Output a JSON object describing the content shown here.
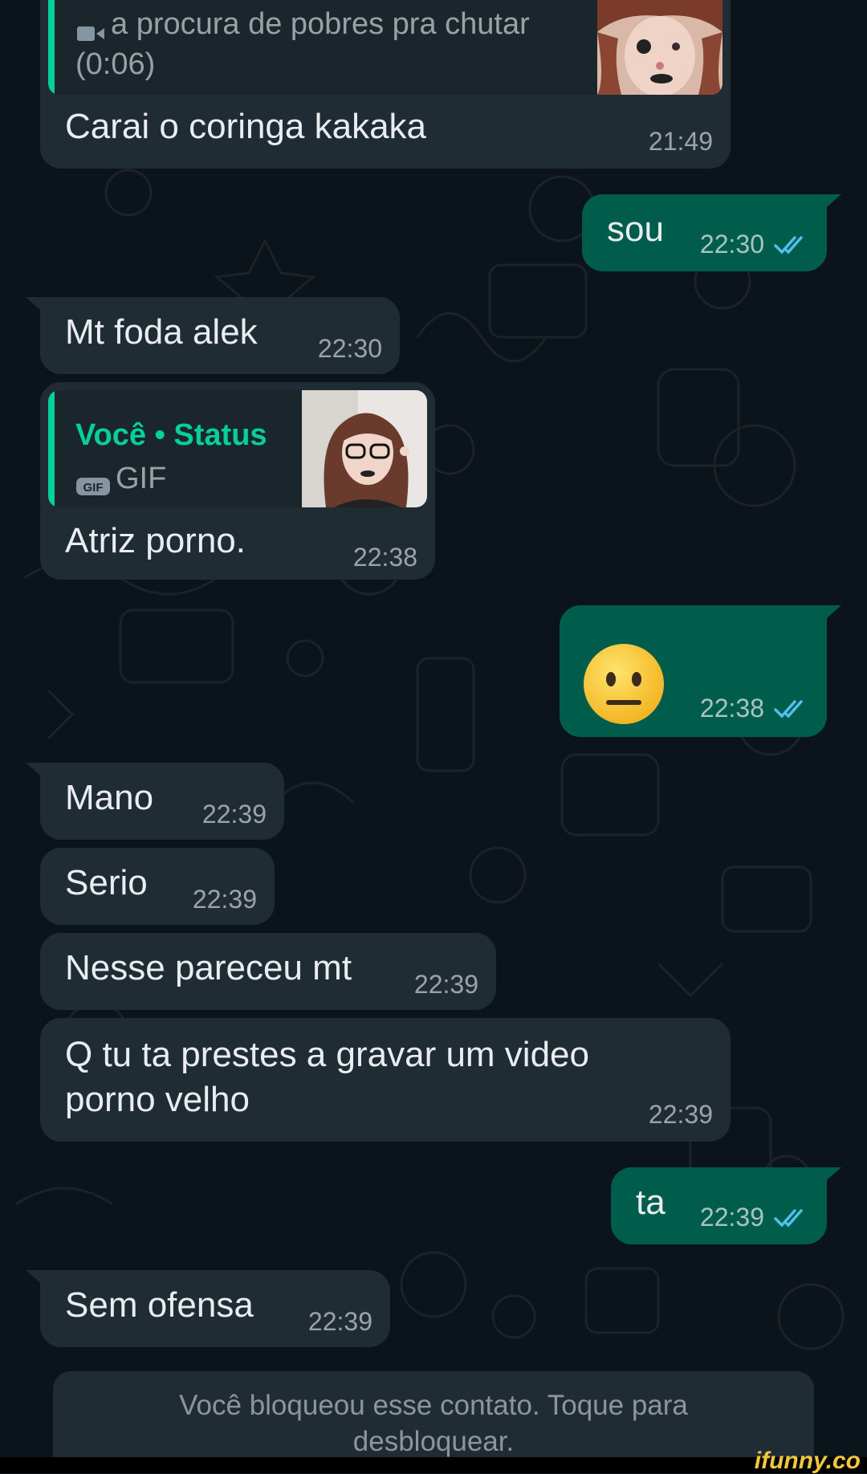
{
  "messages": {
    "m1": {
      "quote_text": "a procura de pobres pra chutar",
      "quote_duration": "(0:06)",
      "text": "Carai o coringa kakaka",
      "time": "21:49"
    },
    "m2": {
      "text": "sou",
      "time": "22:30",
      "status": "read"
    },
    "m3": {
      "text": "Mt foda alek",
      "time": "22:30"
    },
    "m4": {
      "quote_author": "Você • Status",
      "quote_media": "GIF",
      "text": "Atriz porno.",
      "time": "22:38"
    },
    "m5": {
      "emoji": "😐",
      "time": "22:38",
      "status": "read"
    },
    "m6": {
      "text": "Mano",
      "time": "22:39"
    },
    "m7": {
      "text": "Serio",
      "time": "22:39"
    },
    "m8": {
      "text": "Nesse pareceu mt",
      "time": "22:39"
    },
    "m9": {
      "text": "Q tu ta prestes a gravar um video\nporno velho",
      "time": "22:39"
    },
    "m10": {
      "text": "ta",
      "time": "22:39",
      "status": "read"
    },
    "m11": {
      "text": "Sem ofensa",
      "time": "22:39"
    }
  },
  "blocked_banner": "Você bloqueou esse contato. Toque para\ndesbloquear.",
  "watermark": "ifunny.co",
  "colors": {
    "background": "#0b141a",
    "incoming_bubble": "#202c33",
    "outgoing_bubble": "#005c4b",
    "accent": "#06cf9c",
    "read_ticks": "#53bdeb"
  },
  "icons": [
    "video-camera-icon",
    "gif-icon",
    "double-check-icon"
  ]
}
